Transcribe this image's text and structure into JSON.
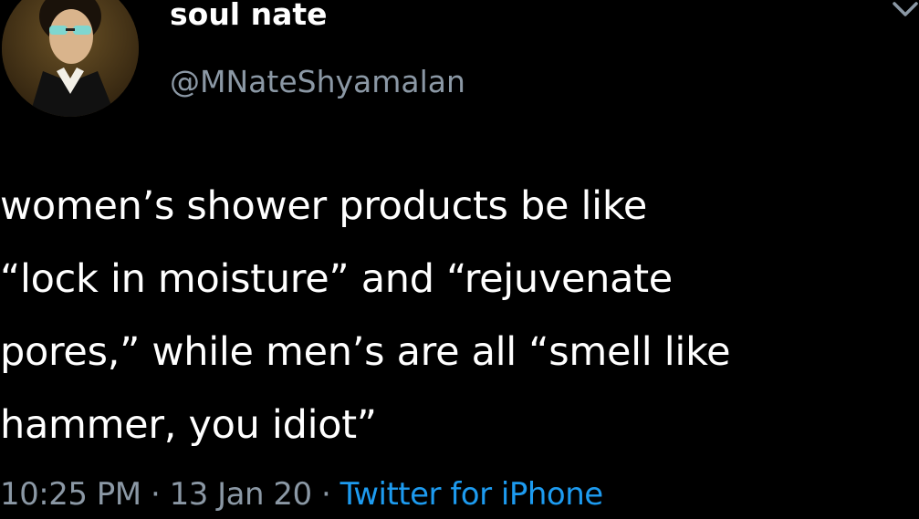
{
  "tweet": {
    "author": {
      "display_name": "soul nate",
      "handle": "@MNateShyamalan"
    },
    "text_lines": [
      "women’s shower products be like",
      "“lock in moisture” and “rejuvenate",
      "pores,” while men’s are all “smell like",
      "hammer, you idiot”"
    ],
    "meta": {
      "time": "10:25 PM",
      "separator_1": " · ",
      "date": "13 Jan 20",
      "separator_2": " · ",
      "source": "Twitter for iPhone"
    },
    "menu_icon": "chevron-down-icon"
  },
  "colors": {
    "background": "#000000",
    "text": "#ffffff",
    "secondary": "#8b98a5",
    "accent": "#1d9bf0"
  }
}
